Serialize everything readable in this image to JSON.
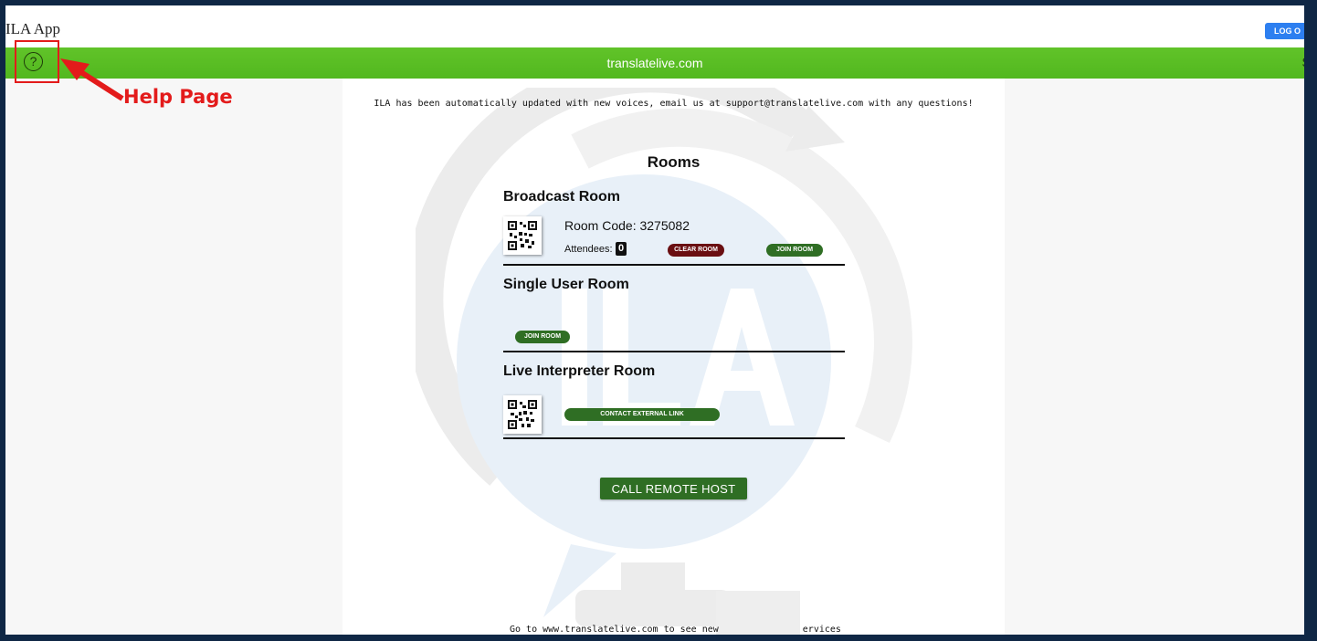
{
  "app": {
    "title": "ILA App",
    "logout_label": "LOG O"
  },
  "green_bar": {
    "site": "translatelive.com",
    "right_edge_text": "$"
  },
  "annotation": {
    "help_label": "Help Page",
    "color": "#e31b1b"
  },
  "notice": "ILA has been automatically updated with new voices, email us at support@translatelive.com with any questions!",
  "rooms": {
    "heading": "Rooms",
    "broadcast": {
      "title": "Broadcast Room",
      "room_code": "Room Code: 3275082",
      "attendees_label": "Attendees:",
      "attendees_count": "0",
      "clear_label": "CLEAR ROOM",
      "join_label": "JOIN ROOM"
    },
    "single": {
      "title": "Single User Room",
      "join_label": "JOIN ROOM"
    },
    "interpreter": {
      "title": "Live Interpreter Room",
      "contact_label": "CONTACT EXTERNAL LINK"
    }
  },
  "call_remote_host": "CALL REMOTE HOST",
  "footer": {
    "left": "Go to www.translatelive.com to see new",
    "right": "ervices"
  },
  "colors": {
    "frame": "#0f2745",
    "green_bar": "#5bbf24",
    "button_green": "#2f6e24",
    "button_red": "#6a0f12",
    "logout_blue": "#2d7ff0"
  },
  "icons": {
    "help": "question-circle-icon",
    "qr": "qr-code-icon"
  }
}
